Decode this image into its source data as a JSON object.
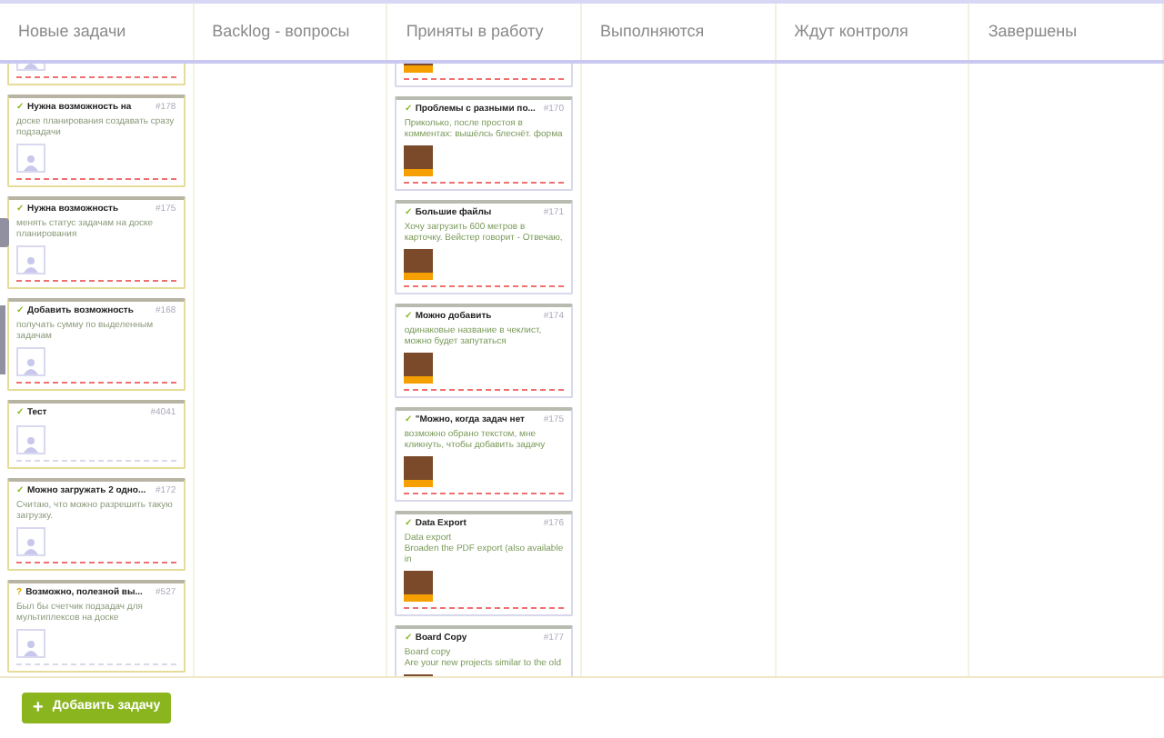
{
  "columns": [
    {
      "title": "Новые задачи",
      "cards": [
        {
          "has_photo": false
        },
        {
          "kind": "check",
          "mark": "✓",
          "title": "Нужна возможность на",
          "number": "#178",
          "text": "доске планирования создавать сразу подзадачи",
          "has_photo": false
        },
        {
          "kind": "check",
          "mark": "✓",
          "title": "Нужна возможность",
          "number": "#175",
          "text": "менять статус задачам на доске планирования",
          "has_photo": false
        },
        {
          "kind": "check",
          "mark": "✓",
          "title": "Добавить возможность",
          "number": "#168",
          "text": "получать сумму по выделенным задачам",
          "has_photo": false
        },
        {
          "kind": "check",
          "mark": "✓",
          "title": "Тест",
          "number": "#4041",
          "has_photo": false
        },
        {
          "kind": "check",
          "mark": "✓",
          "title": "Можно загружать 2 одно...",
          "number": "#172",
          "text": "Считаю, что можно разрешить такую загрузку.",
          "has_photo": false
        },
        {
          "kind": "question",
          "mark": "?",
          "title": "Возможно, полезной вы...",
          "number": "#527",
          "text": "Был бы счетчик подзадач для мультиплексов на доске",
          "has_photo": false
        }
      ]
    },
    {
      "title": "Backlog - вопросы"
    },
    {
      "title": "Приняты в работу",
      "cards": [
        {
          "has_photo": true
        },
        {
          "kind": "check",
          "mark": "✓",
          "title": "Проблемы с разными по...",
          "number": "#170",
          "text": "Приколько, после простоя в комментах: вышёлсь блеснёт. форма",
          "has_photo": true
        },
        {
          "kind": "check",
          "mark": "✓",
          "title": "Большие файлы",
          "number": "#171",
          "text": "Хочу загрузить 600 метров в карточку. Вейстер говорит - Отвечаю,",
          "has_photo": true
        },
        {
          "kind": "check",
          "mark": "✓",
          "title": "Можно добавить",
          "number": "#174",
          "text": "одинаковые название в чеклист, можно будет запутаться",
          "has_photo": true
        },
        {
          "kind": "check",
          "mark": "✓",
          "title": "\"Можно, когда задач нет",
          "number": "#175",
          "text": "возможно обрано текстом, мне кликнуть, чтобы добавить задачу",
          "has_photo": true
        },
        {
          "kind": "check",
          "mark": "✓",
          "title": "Data Export",
          "number": "#176",
          "text": "Data export\nBroaden the PDF export (also available in",
          "has_photo": true
        },
        {
          "kind": "check",
          "mark": "✓",
          "title": "Board Copy",
          "number": "#177",
          "text": "Board copy\nAre your new projects similar to the old",
          "has_photo": true
        }
      ]
    },
    {
      "title": "Выполняются"
    },
    {
      "title": "Ждут контроля"
    },
    {
      "title": "Завершены"
    }
  ],
  "add_button": {
    "icon": "+",
    "label": "Добавить задачу"
  }
}
